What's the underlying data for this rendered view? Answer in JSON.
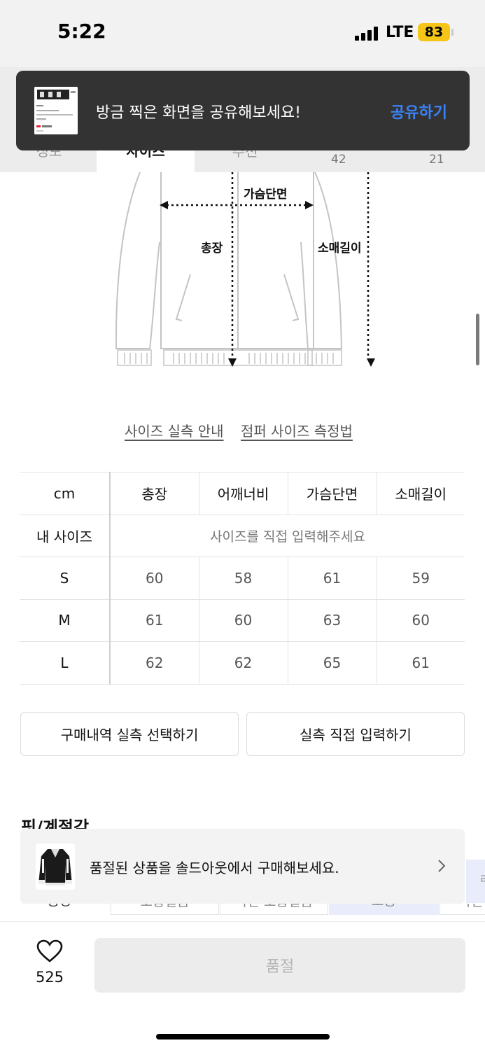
{
  "status_bar": {
    "time": "5:22",
    "network": "LTE",
    "battery": "83"
  },
  "tabs": {
    "left": "정보",
    "active": "사이즈",
    "middle": "추천",
    "counts": [
      "42",
      "21"
    ]
  },
  "toast": {
    "message": "방금 찍은 화면을 공유해보세요!",
    "action": "공유하기"
  },
  "diagram": {
    "chest": "가슴단면",
    "length": "총장",
    "sleeve": "소매길이"
  },
  "guide_links": {
    "size_guide": "사이즈 실측 안내",
    "measure_guide": "점퍼 사이즈 측정법"
  },
  "size_table": {
    "unit": "cm",
    "columns": [
      "총장",
      "어깨너비",
      "가슴단면",
      "소매길이"
    ],
    "my_size_label": "내 사이즈",
    "my_size_hint": "사이즈를 직접 입력해주세요",
    "rows": [
      {
        "size": "S",
        "values": [
          "60",
          "58",
          "61",
          "59"
        ]
      },
      {
        "size": "M",
        "values": [
          "61",
          "60",
          "63",
          "60"
        ]
      },
      {
        "size": "L",
        "values": [
          "62",
          "62",
          "65",
          "61"
        ]
      }
    ]
  },
  "buttons": {
    "select_purchase": "구매내역 실측 선택하기",
    "direct_input": "실측 직접 입력하기"
  },
  "fit_section": {
    "title": "핏/계절감"
  },
  "soldout_banner": {
    "text": "품절된 상품을 솔드아웃에서 구매해보세요.",
    "peek": "ㄹ"
  },
  "fit_chips": {
    "label": "총장",
    "options": [
      "보통길음",
      "약간 보통길음",
      "보통",
      "약간"
    ]
  },
  "bottom_bar": {
    "like_count": "525",
    "buy_label": "품절"
  },
  "colors": {
    "accent": "#3b82f6",
    "battery": "#f5c518",
    "toast_bg": "#333333"
  }
}
